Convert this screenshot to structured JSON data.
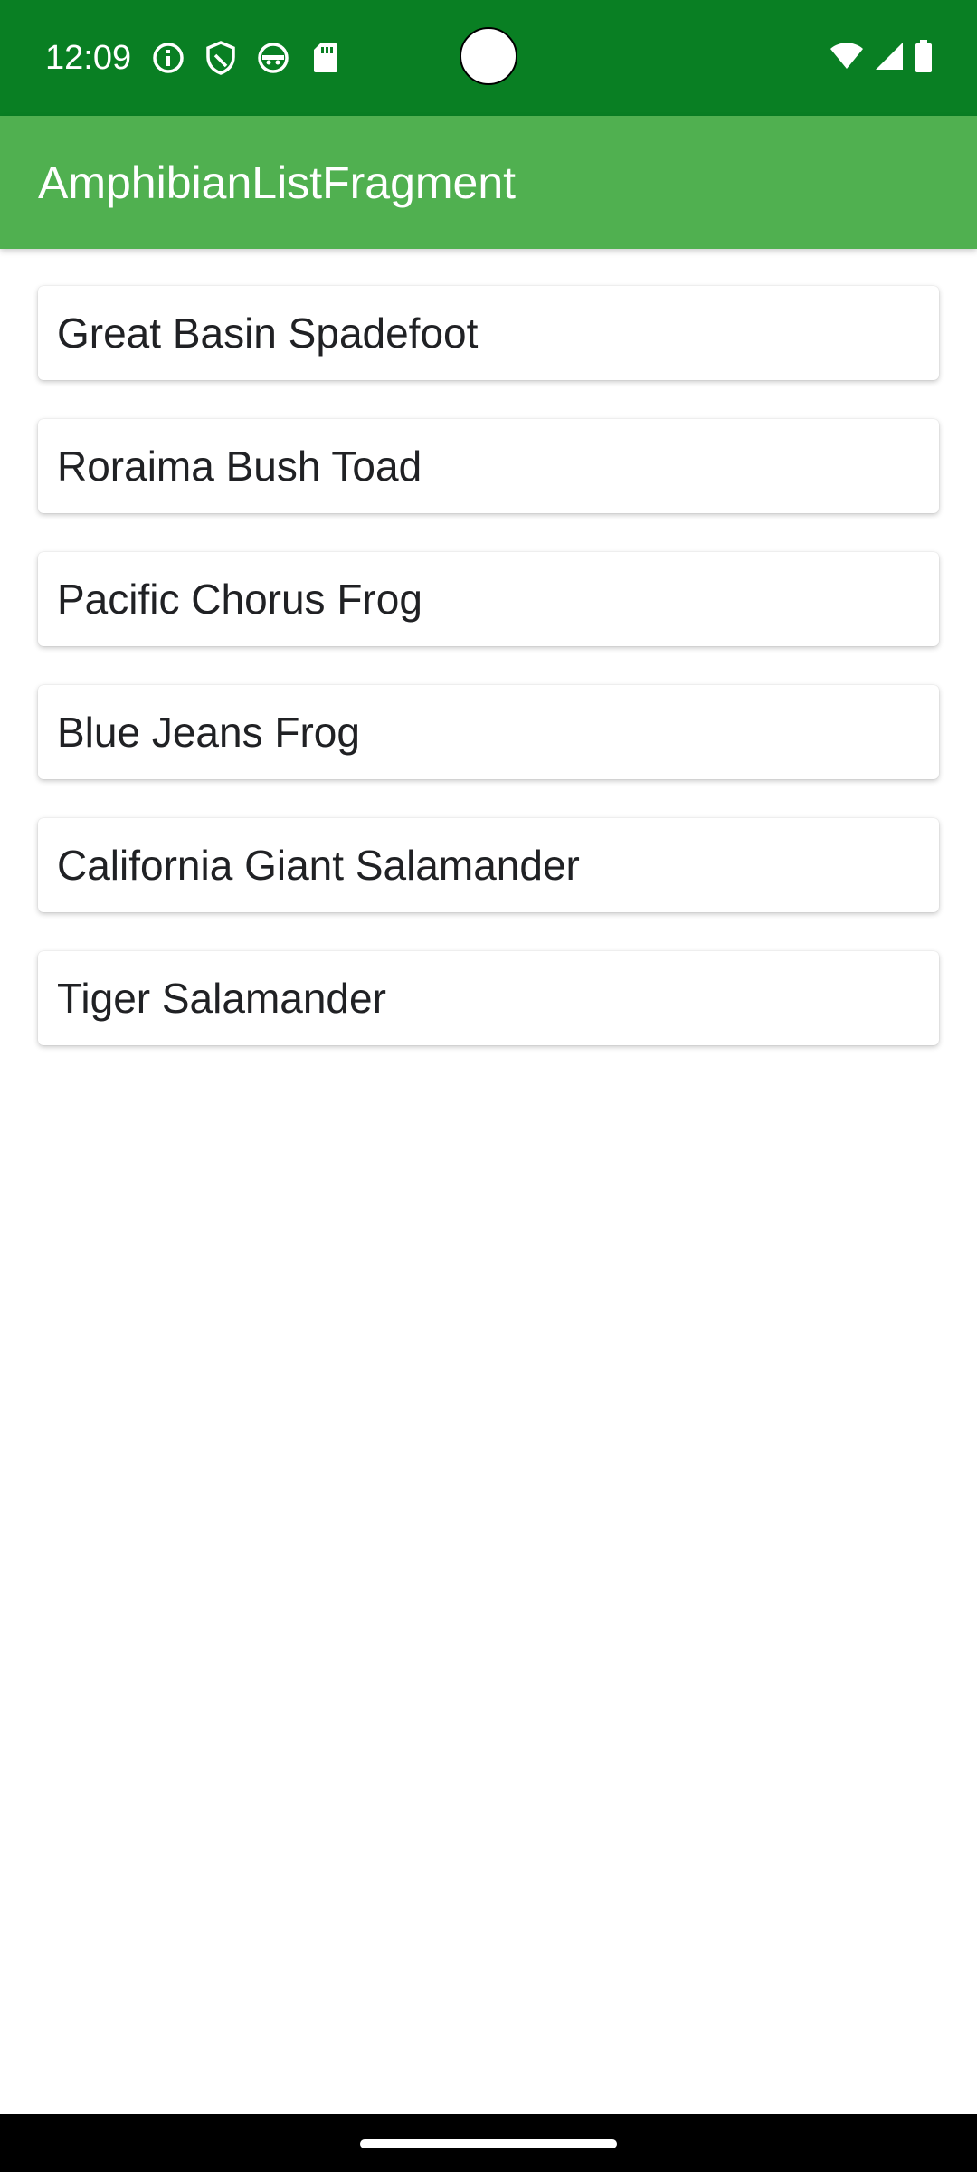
{
  "status_bar": {
    "time": "12:09",
    "left_icons": [
      "info-icon",
      "shield-icon",
      "android-face-icon",
      "sd-card-icon"
    ],
    "right_icons": [
      "wifi-icon",
      "cellular-signal-icon",
      "battery-icon"
    ],
    "background_color": "#097f23"
  },
  "app_bar": {
    "title": "AmphibianListFragment",
    "background_color": "#50b050"
  },
  "amphibians": [
    "Great Basin Spadefoot",
    "Roraima Bush Toad",
    "Pacific Chorus Frog",
    "Blue Jeans Frog",
    "California Giant Salamander",
    "Tiger Salamander"
  ]
}
